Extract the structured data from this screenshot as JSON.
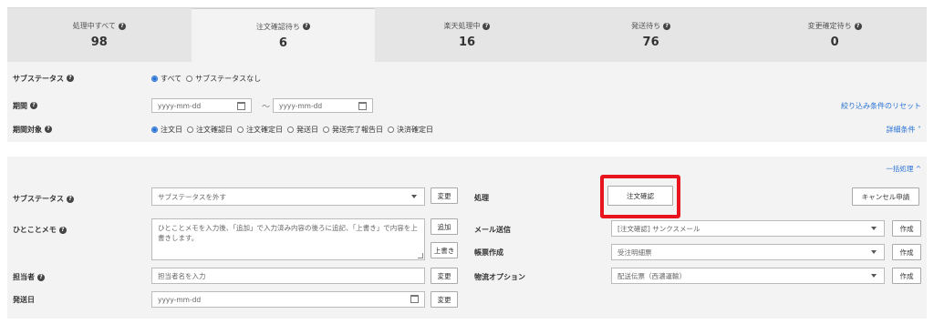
{
  "status_tabs": [
    {
      "label": "処理中すべて",
      "count": "98"
    },
    {
      "label": "注文確認待ち",
      "count": "6"
    },
    {
      "label": "楽天処理中",
      "count": "16"
    },
    {
      "label": "発送待ち",
      "count": "76"
    },
    {
      "label": "変更確定待ち",
      "count": "0"
    }
  ],
  "active_tab": "注文確認待ち",
  "filters": {
    "substatus_label": "サブステータス",
    "substatus_options": [
      "すべて",
      "サブステータスなし"
    ],
    "substatus_selected": "すべて",
    "period_label": "期間",
    "date_from_placeholder": "yyyy-mm-dd",
    "date_to_placeholder": "yyyy-mm-dd",
    "reset_link": "絞り込み条件のリセット",
    "period_target_label": "期間対象",
    "period_target_options": [
      "注文日",
      "注文確認日",
      "注文確定日",
      "発送日",
      "発送完了報告日",
      "決済確定日"
    ],
    "period_target_selected": "注文日",
    "detail_link": "詳細条件 ˅"
  },
  "bulk": {
    "toggle_link": "一括処理 ^",
    "substatus_label": "サブステータス",
    "substatus_select": "サブステータスを外す",
    "change_label": "変更",
    "memo_label": "ひとことメモ",
    "memo_placeholder": "ひとことメモを入力後、「追加」で入力済み内容の後ろに追記、「上書き」で内容を上書きします。",
    "add_label": "追加",
    "overwrite_label": "上書き",
    "assignee_label": "担当者",
    "assignee_placeholder": "担当者名を入力",
    "ship_date_label": "発送日",
    "ship_date_placeholder": "yyyy-mm-dd",
    "process_label": "処理",
    "confirm_order_button": "注文確認",
    "cancel_request_button": "キャンセル申請",
    "mail_label": "メール送信",
    "mail_select": "[注文確認] サンクスメール",
    "create_label": "作成",
    "form_label": "帳票作成",
    "form_select": "受注明細票",
    "logistics_label": "物流オプション",
    "logistics_select": "配送伝票（西濃運輸）"
  },
  "colors": {
    "highlight": "#e8141e",
    "link": "#2a72d6",
    "tab_bg": "#e5e5e5",
    "panel_bg": "#f3f3f3"
  }
}
